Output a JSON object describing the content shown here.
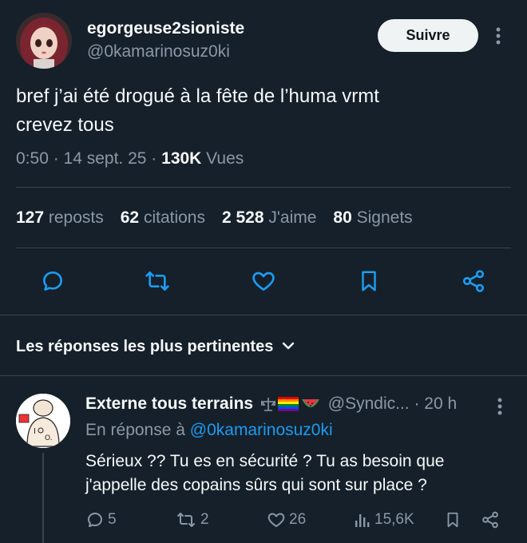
{
  "tweet": {
    "display_name": "egorgeuse2sioniste",
    "handle": "@0kamarinosuz0ki",
    "follow_label": "Suivre",
    "text_line1": "bref j’ai été drogué à la fête de l’huma vrmt",
    "text_line2": "crevez tous",
    "time": "0:50",
    "sep1": " · ",
    "date": "14 sept. 25",
    "sep2": " · ",
    "views_count": "130K",
    "views_label": " Vues"
  },
  "stats": {
    "reposts_num": "127",
    "reposts_label": " reposts",
    "quotes_num": "62",
    "quotes_label": " citations",
    "likes_num": "2 528",
    "likes_label": " J'aime",
    "bookmarks_num": "80",
    "bookmarks_label": " Signets"
  },
  "replies_section": {
    "title": "Les réponses les plus pertinentes"
  },
  "reply": {
    "display_name": "Externe tous terrains",
    "handle": "@Syndic...",
    "sep": " · ",
    "age": "20 h",
    "reply_prefix": "En réponse à ",
    "reply_to": "@0kamarinosuz0ki",
    "text_line1": "Sérieux ?? Tu es en sécurité ? Tu as besoin que",
    "text_line2": "j'appelle des copains sûrs qui sont sur place ?",
    "replies": "5",
    "reposts": "2",
    "likes": "26",
    "views": "15,6K"
  },
  "colors": {
    "background": "#15202b",
    "text": "#f7f9f9",
    "muted": "#8b98a5",
    "link": "#1d9bf0",
    "divider": "#38444d"
  },
  "icons": [
    "more-icon",
    "reply-icon",
    "repost-icon",
    "like-icon",
    "bookmark-icon",
    "share-icon",
    "chevron-down-icon",
    "views-icon"
  ]
}
